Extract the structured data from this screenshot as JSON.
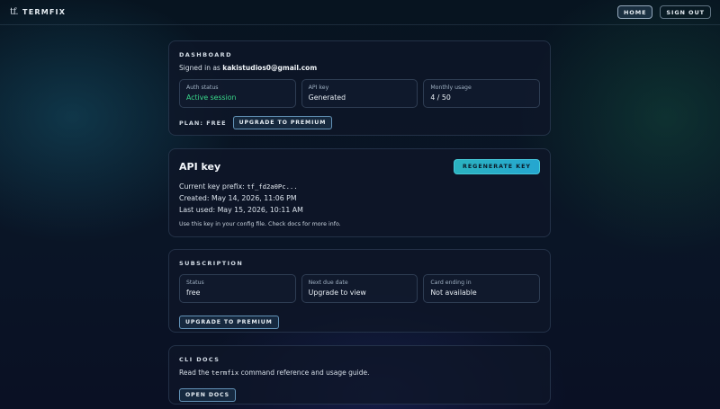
{
  "header": {
    "logo": "tf.",
    "brand": "TERMFIX",
    "nav": [
      {
        "label": "HOME",
        "active": true
      },
      {
        "label": "SIGN OUT",
        "active": false
      }
    ]
  },
  "dashboard": {
    "label": "DASHBOARD",
    "signed_in_prefix": "Signed in as ",
    "email": "kakistudios0@gmail.com",
    "stats": [
      {
        "label": "Auth status",
        "value": "Active session"
      },
      {
        "label": "API key",
        "value": "Generated"
      },
      {
        "label": "Monthly usage",
        "value": "4 / 50"
      }
    ],
    "plan_text": "PLAN: FREE",
    "upgrade_label": "UPGRADE TO PREMIUM"
  },
  "api_key": {
    "title": "API key",
    "regenerate_label": "REGENERATE KEY",
    "prefix_label": "Current key prefix: ",
    "prefix_value": "tf_fd2a0Pc...",
    "created": "Created: May 14, 2026, 11:06 PM",
    "last_used": "Last used: May 15, 2026, 10:11 AM",
    "hint": "Use this key in your config file. Check docs for more info."
  },
  "subscription": {
    "label": "SUBSCRIPTION",
    "stats": [
      {
        "label": "Status",
        "value": "free"
      },
      {
        "label": "Next due date",
        "value": "Upgrade to view"
      },
      {
        "label": "Card ending in",
        "value": "Not available"
      }
    ],
    "upgrade_label": "UPGRADE TO PREMIUM"
  },
  "cli_docs": {
    "label": "CLI DOCS",
    "text_before": "Read the ",
    "command": "termfix",
    "text_after": " command reference and usage guide.",
    "button_label": "OPEN DOCS"
  },
  "colors": {
    "accent": "#2bb3c0",
    "success": "#39d98a",
    "background": "#0a1526"
  }
}
